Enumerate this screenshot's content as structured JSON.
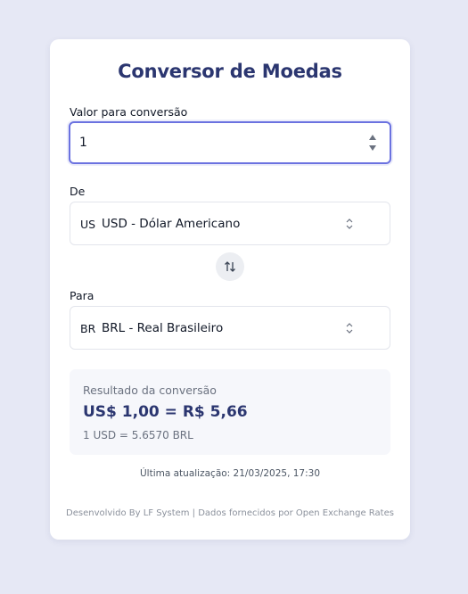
{
  "title": "Conversor de Moedas",
  "amount": {
    "label": "Valor para conversão",
    "value": "1"
  },
  "from": {
    "label": "De",
    "code": "US",
    "option": "USD - Dólar Americano"
  },
  "to": {
    "label": "Para",
    "code": "BR",
    "option": "BRL - Real Brasileiro"
  },
  "result": {
    "label": "Resultado da conversão",
    "value": "US$ 1,00 = R$ 5,66",
    "rate": "1 USD = 5.6570 BRL"
  },
  "last_updated": "Última atualização: 21/03/2025, 17:30",
  "footer": "Desenvolvido By LF System | Dados fornecidos por Open Exchange Rates",
  "colors": {
    "background": "#e6e8f5",
    "accent": "#6b72e0",
    "title": "#2b3670"
  },
  "icons": {
    "swap": "swap-vertical-arrows-icon",
    "select": "chevron-up-down-icon",
    "spinner": "number-spinner-icon"
  }
}
